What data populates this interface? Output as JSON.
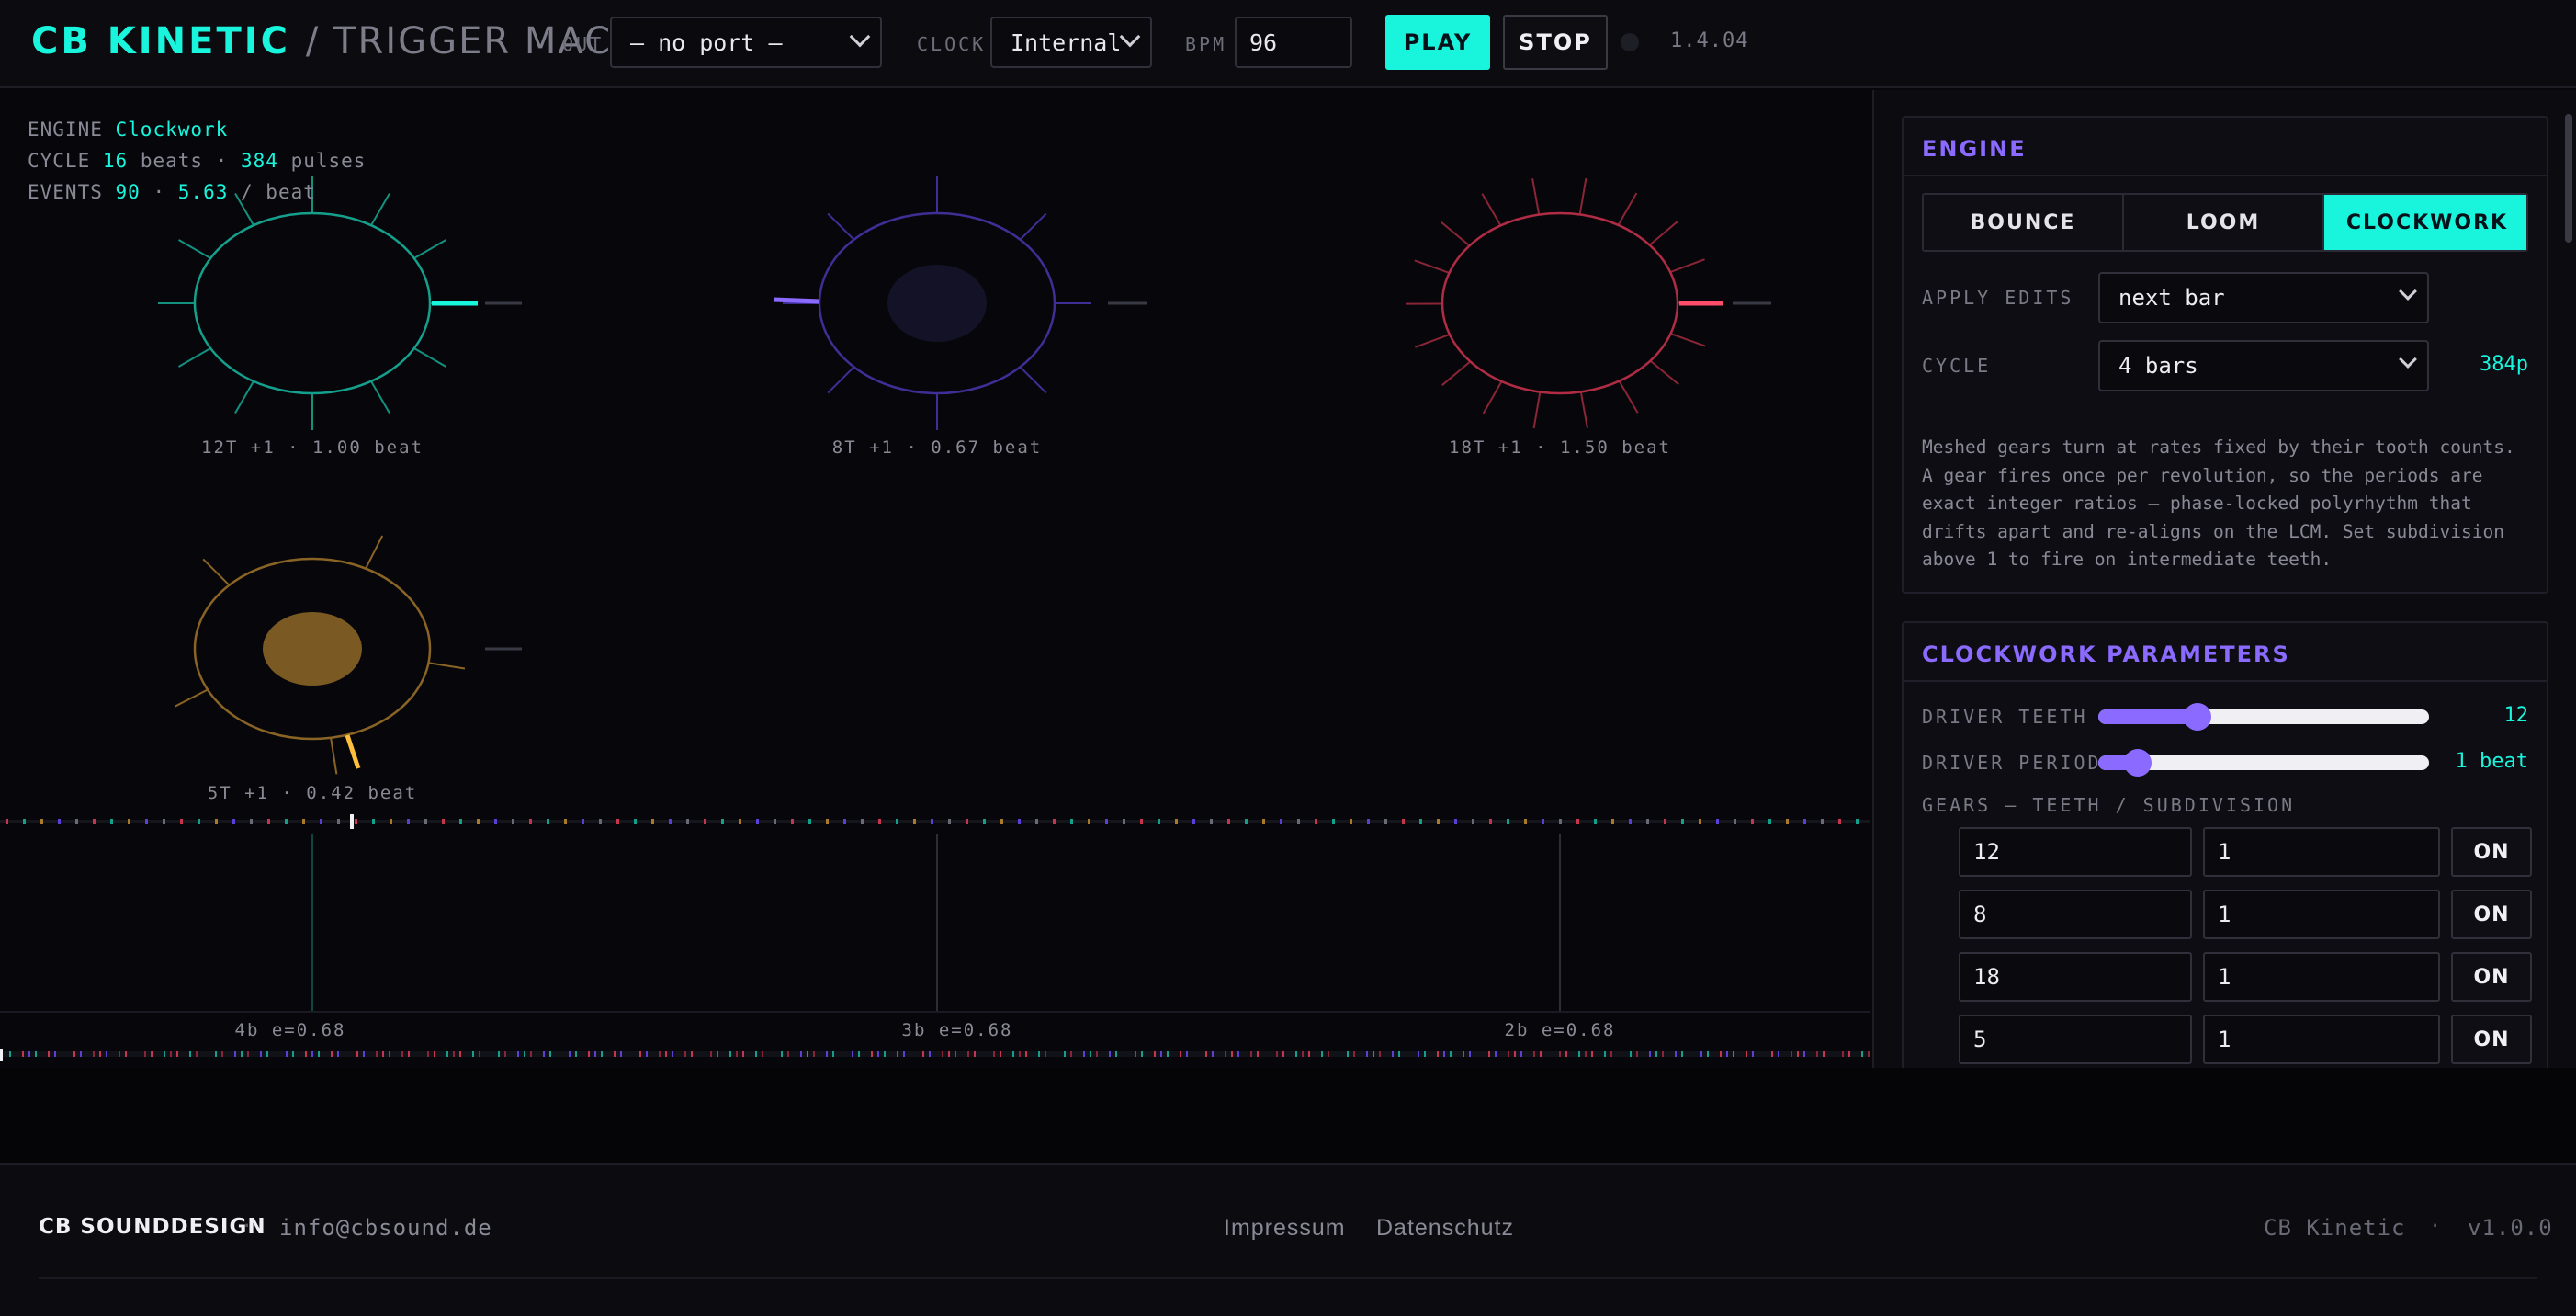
{
  "header": {
    "brand": "CB KINETIC",
    "brand_sub": "/ TRIGGER MACHINE",
    "out_label": "OUT",
    "out_value": "— no port —",
    "clock_label": "CLOCK",
    "clock_value": "Internal",
    "bpm_label": "BPM",
    "bpm_value": "96",
    "play_label": "PLAY",
    "stop_label": "STOP",
    "version": "1.4.04"
  },
  "info": {
    "engine_label": "ENGINE",
    "engine_value": "Clockwork",
    "cycle_label": "CYCLE",
    "cycle_beats": "16",
    "cycle_beats_unit": "beats ·",
    "cycle_pulses": "384",
    "cycle_pulses_unit": "pulses",
    "events_label": "EVENTS",
    "events_value": "90",
    "events_sep": "·",
    "events_rate": "5.63",
    "events_unit": "/ beat"
  },
  "gears": [
    {
      "label": "12T +1 · 1.00 beat",
      "teeth": 12,
      "color": "#14a08c"
    },
    {
      "label": "8T +1 · 0.67 beat",
      "teeth": 8,
      "color": "#5b3fd6"
    },
    {
      "label": "18T +1 · 1.50 beat",
      "teeth": 18,
      "color": "#c8354f"
    },
    {
      "label": "5T +1 · 0.42 beat",
      "teeth": 5,
      "color": "#a87a2a"
    }
  ],
  "lanes": [
    {
      "label": "4b  e=0.68",
      "color": "#14a08c"
    },
    {
      "label": "3b  e=0.68",
      "color": "#5b3fd6"
    },
    {
      "label": "2b  e=0.68",
      "color": "#c8354f"
    }
  ],
  "panel": {
    "engine_title": "ENGINE",
    "modes": [
      "BOUNCE",
      "LOOM",
      "CLOCKWORK"
    ],
    "active_mode": "CLOCKWORK",
    "apply_label": "APPLY EDITS",
    "apply_value": "next bar",
    "cycle_label": "CYCLE",
    "cycle_value": "4 bars",
    "cycle_pulses": "384p",
    "description": "Meshed gears turn at rates fixed by their tooth counts. A gear fires once per revolution, so the periods are exact integer ratios — phase-locked polyrhythm that drifts apart and re-aligns on the LCM. Set subdivision above 1 to fire on intermediate teeth.",
    "params_title": "CLOCKWORK PARAMETERS",
    "driver_teeth_label": "DRIVER TEETH",
    "driver_teeth_value": "12",
    "driver_teeth_level": 0.3,
    "driver_period_label": "DRIVER PERIOD",
    "driver_period_value": "1 beat",
    "driver_period_level": 0.12,
    "gears_label": "GEARS — TEETH / SUBDIVISION",
    "gear_rows": [
      {
        "teeth": "12",
        "sub": "1",
        "state": "ON"
      },
      {
        "teeth": "8",
        "sub": "1",
        "state": "ON"
      },
      {
        "teeth": "18",
        "sub": "1",
        "state": "ON"
      },
      {
        "teeth": "5",
        "sub": "1",
        "state": "ON"
      }
    ]
  },
  "footer": {
    "brand": "CB SOUNDDESIGN",
    "sep": "·",
    "email": "info@cbsound.de",
    "impressum": "Impressum",
    "datenschutz": "Datenschutz",
    "product": "CB Kinetic",
    "product_sep": "·",
    "product_version": "v1.0.0"
  }
}
